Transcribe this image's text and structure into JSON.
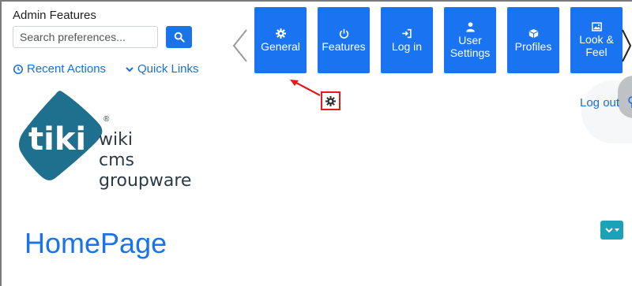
{
  "admin": {
    "title": "Admin Features",
    "search_placeholder": "Search preferences...",
    "recent_actions": "Recent Actions",
    "quick_links": "Quick Links"
  },
  "carousel": {
    "tiles": [
      {
        "label": "General",
        "icon": "gear-icon"
      },
      {
        "label": "Features",
        "icon": "power-icon"
      },
      {
        "label": "Log in",
        "icon": "sign-in-icon"
      },
      {
        "label": "User Settings",
        "icon": "user-icon"
      },
      {
        "label": "Profiles",
        "icon": "cube-icon"
      },
      {
        "label": "Look & Feel",
        "icon": "image-icon"
      }
    ]
  },
  "header": {
    "logo_wiki": "wiki",
    "logo_cms": "cms",
    "logo_groupware": "groupware",
    "logo_word": "tiki",
    "registered": "®",
    "logout": "Log out"
  },
  "main": {
    "page_title": "HomePage"
  },
  "colors": {
    "accent": "#1a73f0",
    "link": "#1a6fd6",
    "teal": "#1aa3b8",
    "highlight": "#e21b1b",
    "logo_teal": "#1f6f8f"
  }
}
